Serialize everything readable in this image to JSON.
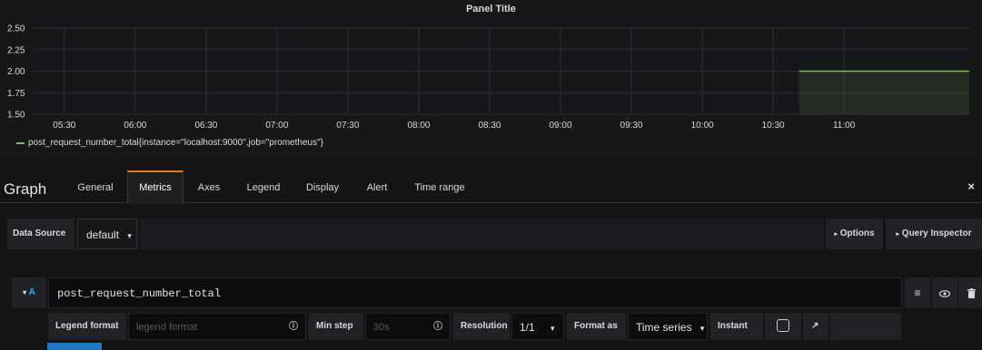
{
  "panel": {
    "title": "Panel Title",
    "legend_text": "post_request_number_total{instance=\"localhost:9000\",job=\"prometheus\"}"
  },
  "chart_data": {
    "type": "area",
    "title": "Panel Title",
    "xlabel": "",
    "ylabel": "",
    "y_ticks": [
      "2.50",
      "2.25",
      "2.00",
      "1.75",
      "1.50"
    ],
    "x_ticks": [
      "05:30",
      "06:00",
      "06:30",
      "07:00",
      "07:30",
      "08:00",
      "08:30",
      "09:00",
      "09:30",
      "10:00",
      "10:30",
      "11:00"
    ],
    "ylim": [
      1.5,
      2.5
    ],
    "xlim": [
      "05:17",
      "11:53"
    ],
    "grid": true,
    "legend_position": "bottom-left",
    "series": [
      {
        "name": "post_request_number_total{instance=\"localhost:9000\",job=\"prometheus\"}",
        "color": "#7eb26d",
        "x": [
          "10:41",
          "11:53"
        ],
        "y": [
          2,
          2
        ]
      }
    ]
  },
  "editor": {
    "title": "Graph",
    "tabs": [
      {
        "label": "General",
        "active": false
      },
      {
        "label": "Metrics",
        "active": true
      },
      {
        "label": "Axes",
        "active": false
      },
      {
        "label": "Legend",
        "active": false
      },
      {
        "label": "Display",
        "active": false
      },
      {
        "label": "Alert",
        "active": false
      },
      {
        "label": "Time range",
        "active": false
      }
    ],
    "close_icon": "×"
  },
  "datasource": {
    "label": "Data Source",
    "value": "default",
    "options_label": "Options",
    "inspector_label": "Query Inspector"
  },
  "query": {
    "ref_id": "A",
    "expr": "post_request_number_total",
    "legend_format_label": "Legend format",
    "legend_format_placeholder": "legend format",
    "min_step_label": "Min step",
    "min_step_placeholder": "30s",
    "resolution_label": "Resolution",
    "resolution_value": "1/1",
    "format_as_label": "Format as",
    "format_as_value": "Time series",
    "instant_label": "Instant",
    "instant_checked": false
  },
  "colors": {
    "background": "#161719",
    "accent_tab": "#eb7b18",
    "series": "#7eb26d",
    "ref_id": "#33b5e5"
  }
}
